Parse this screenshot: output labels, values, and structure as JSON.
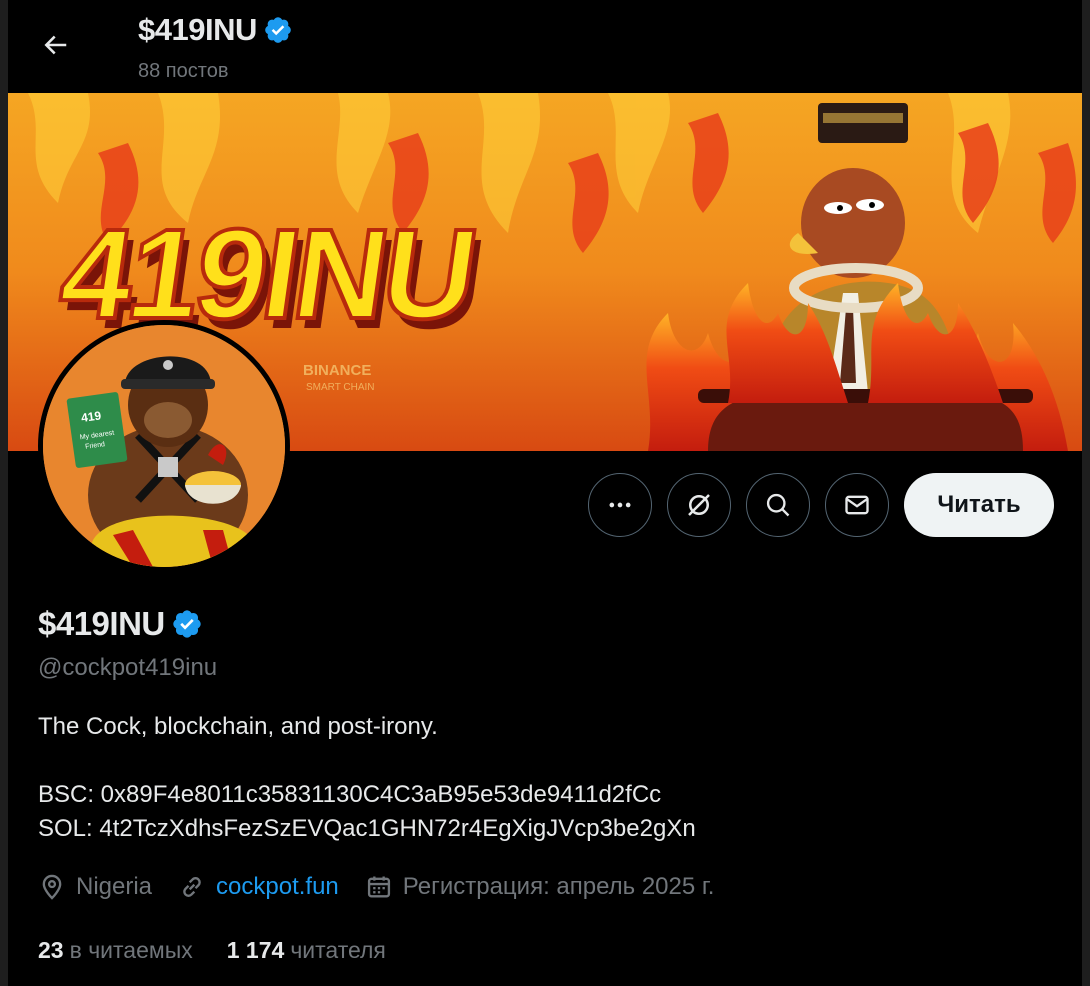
{
  "header": {
    "title": "$419INU",
    "post_count": "88 постов"
  },
  "banner": {
    "text": "419INU",
    "watermark": "BINANCE SMART CHAIN"
  },
  "avatar": {
    "book_title": "419",
    "book_subtitle": "My dearest Friend"
  },
  "actions": {
    "follow_label": "Читать"
  },
  "profile": {
    "name": "$419INU",
    "handle": "@cockpot419inu",
    "bio_line1": "The Cock, blockchain, and post-irony.",
    "bsc": "BSC: 0x89F4e8011c35831130C4C3aB95e53de9411d2fCc",
    "sol": "SOL: 4t2TczXdhsFezSzEVQac1GHN72r4EgXigJVcp3be2gXn",
    "location": "Nigeria",
    "website": "cockpot.fun",
    "joined": "Регистрация: апрель 2025 г."
  },
  "stats": {
    "following_count": "23",
    "following_label": "в читаемых",
    "followers_count": "1 174",
    "followers_label": "читателя"
  },
  "colors": {
    "background": "#000000",
    "accent": "#1d9bf0",
    "secondary_text": "#71767b",
    "verified": "#1d9bf0"
  }
}
